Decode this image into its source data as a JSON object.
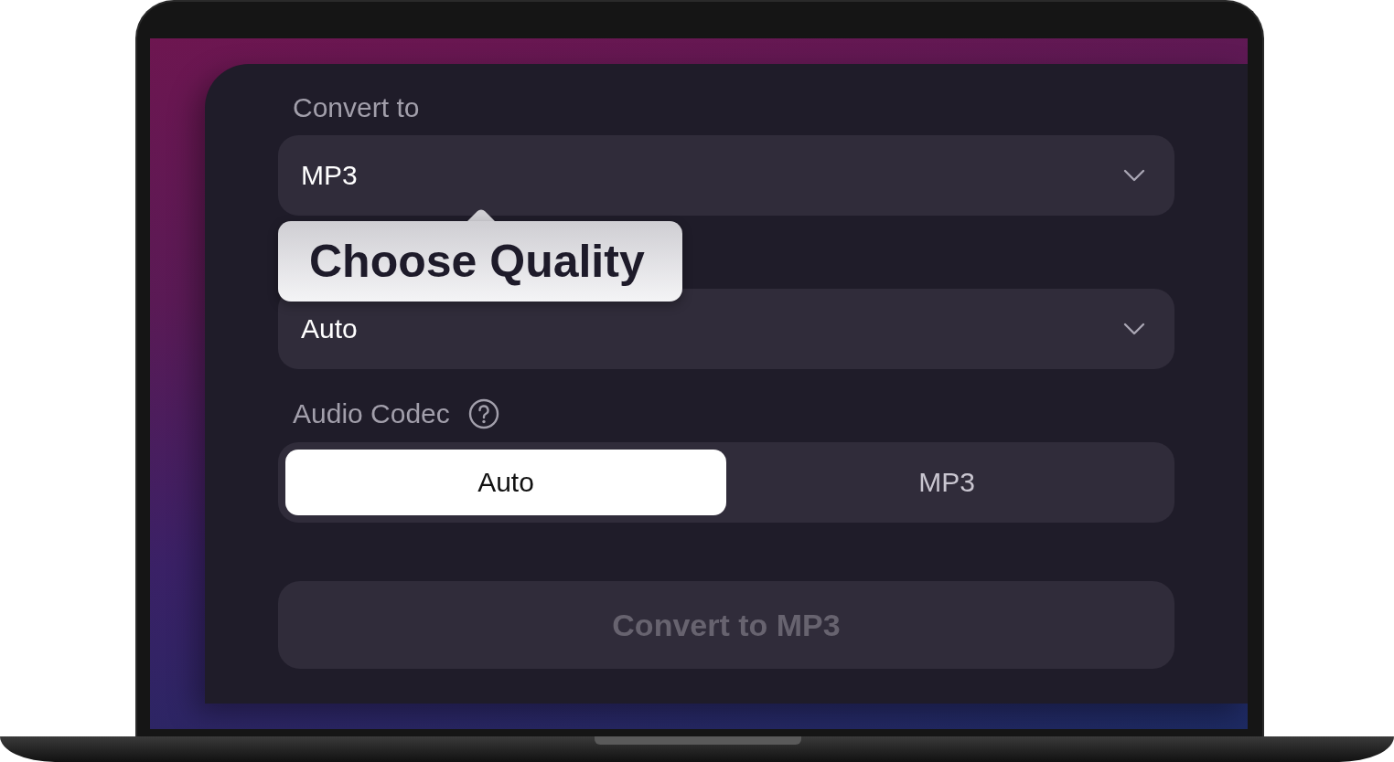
{
  "convert_to": {
    "label": "Convert to",
    "value": "MP3"
  },
  "quality": {
    "value": "Auto"
  },
  "tooltip": {
    "text": "Choose Quality"
  },
  "audio_codec": {
    "label": "Audio Codec",
    "options": [
      {
        "label": "Auto",
        "selected": true
      },
      {
        "label": "MP3",
        "selected": false
      }
    ]
  },
  "convert_button": {
    "label": "Convert to MP3",
    "disabled": true
  }
}
